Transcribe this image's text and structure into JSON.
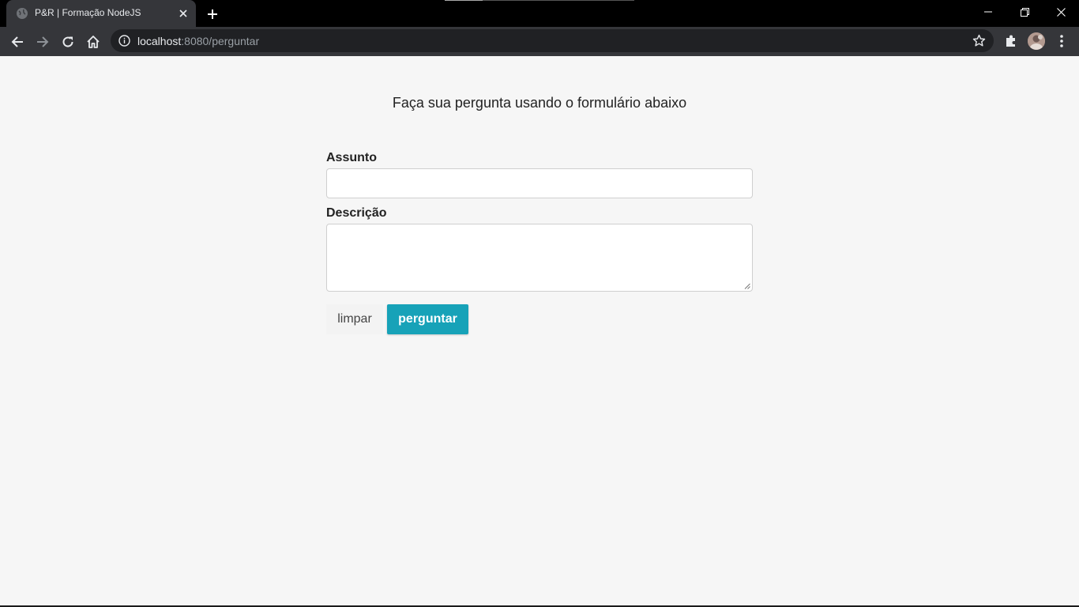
{
  "browser": {
    "tab_title": "P&R | Formação NodeJS",
    "url_host": "localhost",
    "url_path": ":8080/perguntar",
    "icons": {
      "favicon": "globe-icon",
      "tab_close": "close-icon",
      "new_tab": "plus-icon",
      "back": "back-arrow-icon",
      "forward": "forward-arrow-icon",
      "reload": "reload-icon",
      "home": "home-icon",
      "site_info": "info-icon",
      "bookmark": "star-icon",
      "extensions": "puzzle-icon",
      "menu": "kebab-menu-icon"
    }
  },
  "page": {
    "heading": "Faça sua pergunta usando o formulário abaixo",
    "form": {
      "subject_label": "Assunto",
      "subject_value": "",
      "description_label": "Descrição",
      "description_value": "",
      "clear_button": "limpar",
      "submit_button": "perguntar"
    }
  },
  "colors": {
    "submit_button": "#17a2b8",
    "page_background": "#f6f6f6",
    "chrome_toolbar": "#35363a"
  }
}
